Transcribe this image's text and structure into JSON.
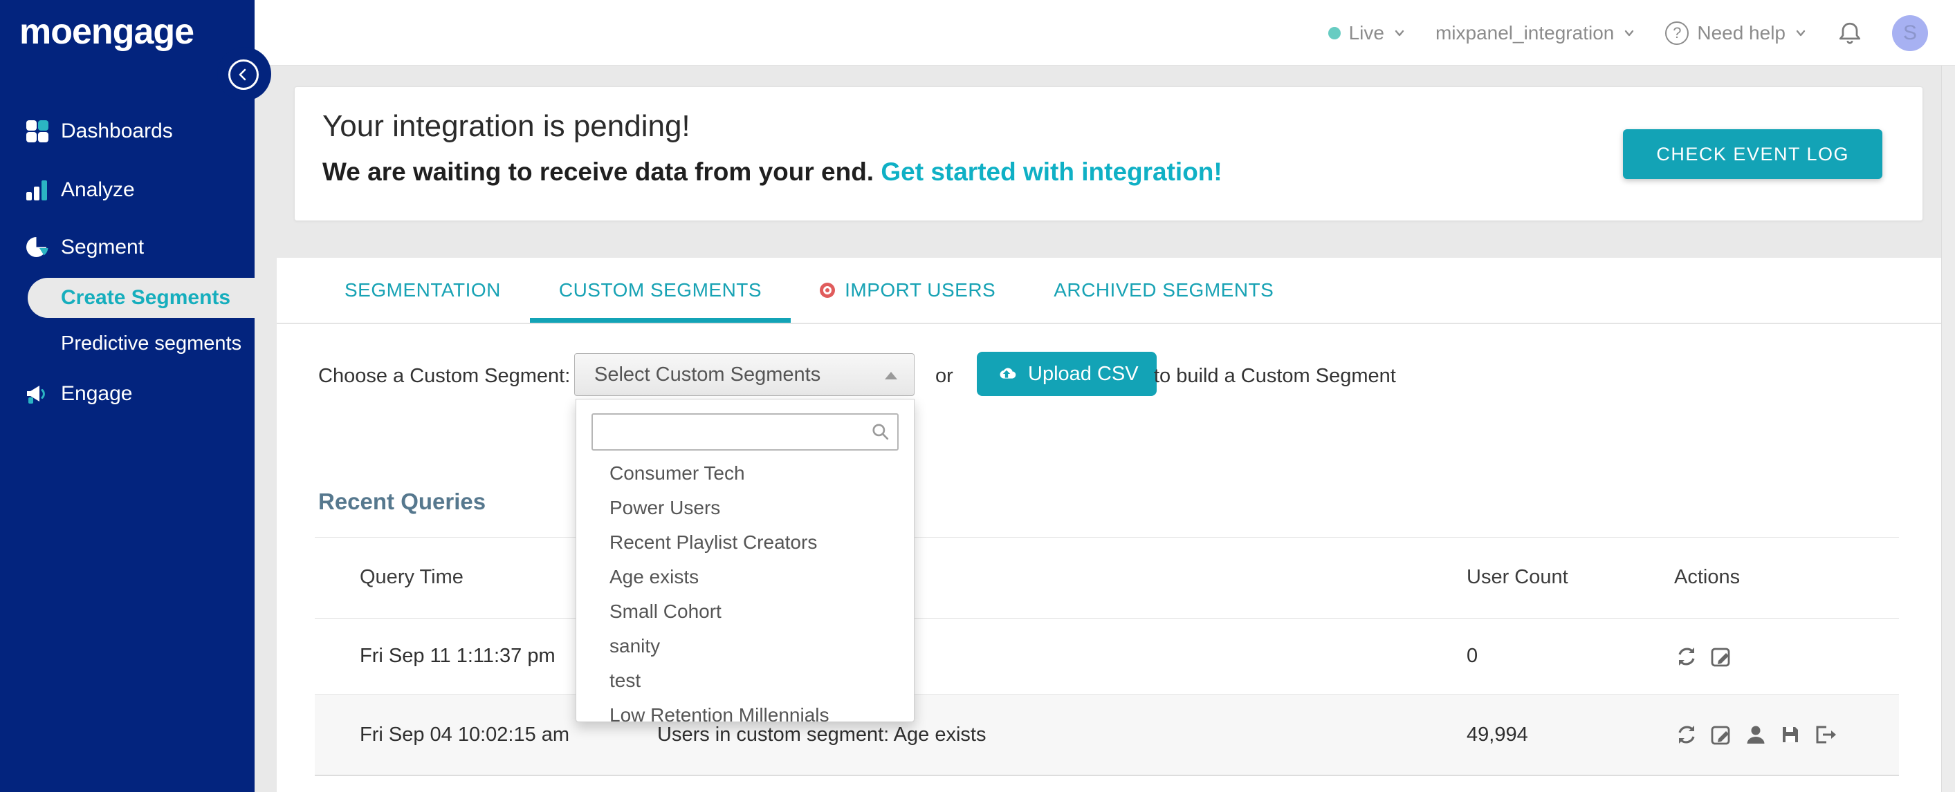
{
  "brand": {
    "logo": "moengage"
  },
  "header": {
    "status": {
      "label": "Live"
    },
    "workspace": "mixpanel_integration",
    "help": "Need help",
    "avatar": "S"
  },
  "sidebar": {
    "items": [
      {
        "label": "Dashboards"
      },
      {
        "label": "Analyze"
      },
      {
        "label": "Segment"
      },
      {
        "label": "Create Segments",
        "active": true
      },
      {
        "label": "Predictive segments"
      },
      {
        "label": "Engage"
      }
    ]
  },
  "banner": {
    "title": "Your integration is pending!",
    "subtitle": "We are waiting to receive data from your end.",
    "link": "Get started with integration!",
    "button": "CHECK EVENT LOG"
  },
  "tabs": [
    {
      "label": "SEGMENTATION"
    },
    {
      "label": "CUSTOM SEGMENTS",
      "active": true
    },
    {
      "label": "IMPORT USERS"
    },
    {
      "label": "ARCHIVED SEGMENTS"
    }
  ],
  "chooser": {
    "label": "Choose a Custom Segment:",
    "select_value": "Select Custom Segments",
    "or_text": "or",
    "upload_button": "Upload CSV",
    "suffix": "to build a Custom Segment"
  },
  "dropdown": {
    "search_value": "",
    "options": [
      "Consumer Tech",
      "Power Users",
      "Recent Playlist Creators",
      "Age exists",
      "Small Cohort",
      "sanity",
      "test",
      "Low Retention Millennials"
    ]
  },
  "recent_queries": {
    "title": "Recent Queries",
    "columns": {
      "time": "Query Time",
      "count": "User Count",
      "actions": "Actions"
    },
    "rows": [
      {
        "time": "Fri Sep 11 1:11:37 pm",
        "info": "",
        "count": "0"
      },
      {
        "time": "Fri Sep 04 10:02:15 am",
        "info": "Users in custom segment: Age exists",
        "count": "49,994"
      }
    ]
  },
  "icons": {
    "live_status": "dot",
    "help": "question-circle",
    "notifications": "bell",
    "collapse": "chevron-left-circle",
    "select_caret": "triangle-up",
    "search": "magnifier",
    "upload": "cloud-upload",
    "import_users": "target-dot",
    "row_actions_row1": [
      "refresh",
      "edit"
    ],
    "row_actions_row2": [
      "refresh",
      "edit",
      "user",
      "save",
      "export"
    ]
  },
  "colors": {
    "navy": "#03247e",
    "accent_teal": "#13a3b6",
    "link_teal": "#0fb0c5",
    "sidebar_active_teal": "#16aebd",
    "slate_heading": "#56788e",
    "import_dot": "#e05c5c",
    "live_dot": "#67ccc2",
    "avatar_bg": "#a7b1f2",
    "page_bg": "#e9e9e9",
    "alt_row_bg": "#f7f7f7"
  }
}
